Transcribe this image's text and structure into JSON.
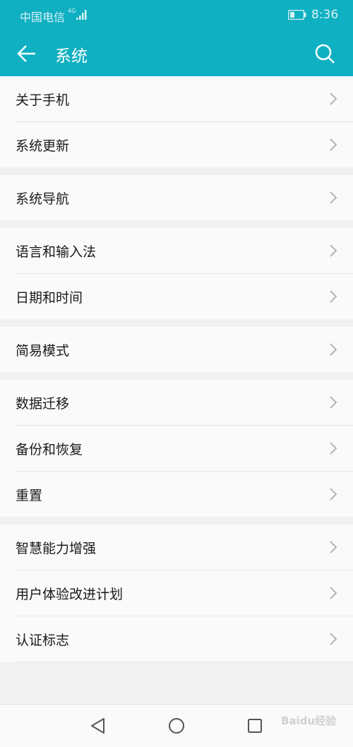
{
  "status_bar": {
    "carrier": "中国电信",
    "network": "4G",
    "time": "8:36"
  },
  "app_bar": {
    "title": "系统",
    "back_icon": "arrow-left-icon",
    "search_icon": "search-icon"
  },
  "groups": [
    {
      "items": [
        "关于手机",
        "系统更新"
      ]
    },
    {
      "items": [
        "系统导航"
      ]
    },
    {
      "items": [
        "语言和输入法",
        "日期和时间"
      ]
    },
    {
      "items": [
        "简易模式"
      ]
    },
    {
      "items": [
        "数据迁移",
        "备份和恢复",
        "重置"
      ]
    },
    {
      "items": [
        "智慧能力增强",
        "用户体验改进计划",
        "认证标志"
      ]
    }
  ],
  "nav_bar": {
    "back_icon": "triangle-back-icon",
    "home_icon": "circle-home-icon",
    "recents_icon": "square-recents-icon"
  },
  "watermark": "Baidu经验",
  "colors": {
    "accent": "#0fb0c2",
    "background": "#f2f2f2",
    "row_background": "#fafafa"
  }
}
